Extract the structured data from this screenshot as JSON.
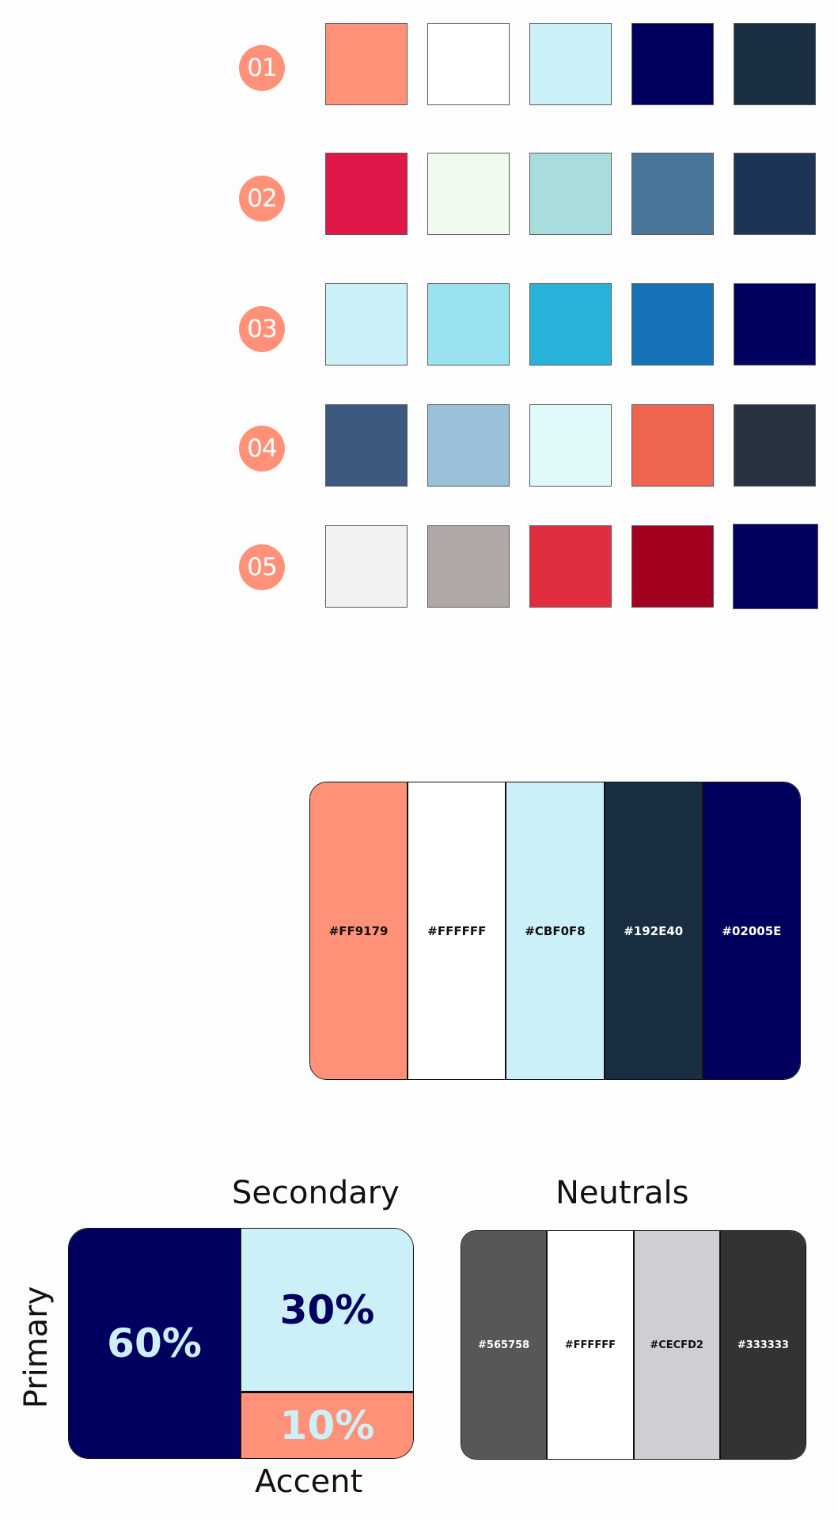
{
  "swatch_rows": [
    {
      "label": "01",
      "colors": [
        "#FF9179",
        "#FFFFFF",
        "#CBF0F8",
        "#02005E",
        "#192E40"
      ]
    },
    {
      "label": "02",
      "colors": [
        "#E0184A",
        "#F0FAEE",
        "#A9DCDC",
        "#4A769A",
        "#1E3456"
      ]
    },
    {
      "label": "03",
      "colors": [
        "#CBF0F8",
        "#98E3EF",
        "#27B3D9",
        "#1672B7",
        "#02005E"
      ]
    },
    {
      "label": "04",
      "colors": [
        "#3C5A80",
        "#9AC0DA",
        "#E0FAFB",
        "#EE6650",
        "#293240"
      ]
    },
    {
      "label": "05",
      "colors": [
        "#F3F1F2",
        "#B0A7A7",
        "#E12D40",
        "#A2011F",
        "#02005E"
      ]
    }
  ],
  "palette": [
    {
      "hex": "#FF9179",
      "text_color": "#111111"
    },
    {
      "hex": "#FFFFFF",
      "text_color": "#111111"
    },
    {
      "hex": "#CBF0F8",
      "text_color": "#111111"
    },
    {
      "hex": "#192E40",
      "text_color": "#FFFFFF"
    },
    {
      "hex": "#02005E",
      "text_color": "#FFFFFF"
    }
  ],
  "ratio": {
    "secondary_title": "Secondary",
    "primary_title": "Primary",
    "accent_title": "Accent",
    "primary_value": "60%",
    "secondary_value": "30%",
    "accent_value": "10%",
    "primary_color": "#02005E",
    "secondary_color": "#CBF0F8",
    "accent_color": "#FF9179"
  },
  "neutrals": {
    "title": "Neutrals",
    "colors": [
      {
        "hex": "#565758",
        "text_color": "#FFFFFF"
      },
      {
        "hex": "#FFFFFF",
        "text_color": "#111111"
      },
      {
        "hex": "#CECFD2",
        "text_color": "#111111"
      },
      {
        "hex": "#333333",
        "text_color": "#FFFFFF"
      }
    ]
  }
}
